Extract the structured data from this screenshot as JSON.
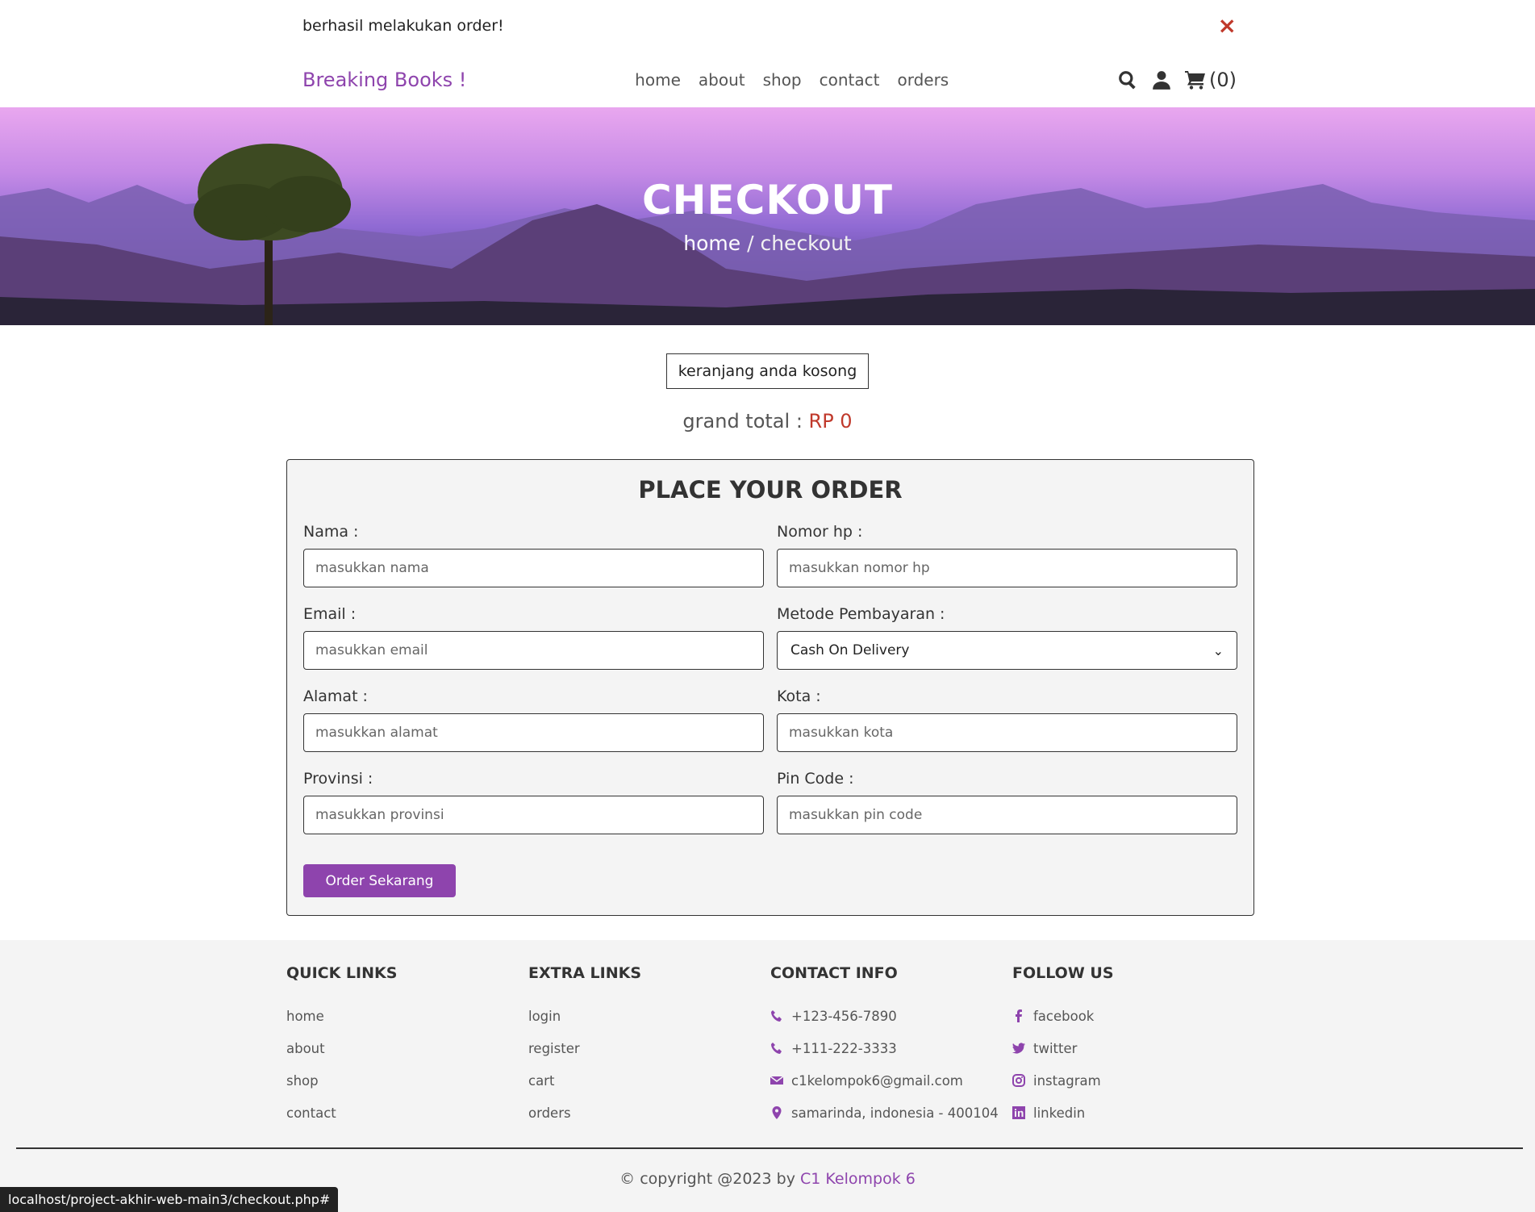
{
  "message": {
    "text": "berhasil melakukan order!",
    "close_icon": "×"
  },
  "header": {
    "logo": "Breaking Books !",
    "nav": [
      "home",
      "about",
      "shop",
      "contact",
      "orders"
    ],
    "cart_count": "(0)"
  },
  "heading": {
    "title": "CHECKOUT",
    "crumb_home": "home",
    "crumb_sep": " / ",
    "crumb_current": "checkout"
  },
  "cart": {
    "empty_text": "keranjang anda kosong",
    "grand_total_label": "grand total : ",
    "grand_total_value": "RP 0"
  },
  "form": {
    "title": "PLACE YOUR ORDER",
    "fields": [
      {
        "label": "Nama :",
        "placeholder": "masukkan nama"
      },
      {
        "label": "Nomor hp :",
        "placeholder": "masukkan nomor hp"
      },
      {
        "label": "Email :",
        "placeholder": "masukkan email"
      },
      {
        "label": "Metode Pembayaran :",
        "selected": "Cash On Delivery"
      },
      {
        "label": "Alamat :",
        "placeholder": "masukkan alamat"
      },
      {
        "label": "Kota :",
        "placeholder": "masukkan kota"
      },
      {
        "label": "Provinsi :",
        "placeholder": "masukkan provinsi"
      },
      {
        "label": "Pin Code :",
        "placeholder": "masukkan pin code"
      }
    ],
    "submit": "Order Sekarang"
  },
  "footer": {
    "quick_links": {
      "title": "QUICK LINKS",
      "items": [
        "home",
        "about",
        "shop",
        "contact"
      ]
    },
    "extra_links": {
      "title": "EXTRA LINKS",
      "items": [
        "login",
        "register",
        "cart",
        "orders"
      ]
    },
    "contact_info": {
      "title": "CONTACT INFO",
      "items": [
        {
          "icon": "phone-icon",
          "text": "+123-456-7890"
        },
        {
          "icon": "phone-icon",
          "text": "+111-222-3333"
        },
        {
          "icon": "envelope-icon",
          "text": "c1kelompok6@gmail.com"
        },
        {
          "icon": "map-marker-icon",
          "text": "samarinda, indonesia - 400104"
        }
      ]
    },
    "follow_us": {
      "title": "FOLLOW US",
      "items": [
        {
          "icon": "facebook-icon",
          "text": "facebook"
        },
        {
          "icon": "twitter-icon",
          "text": "twitter"
        },
        {
          "icon": "instagram-icon",
          "text": "instagram"
        },
        {
          "icon": "linkedin-icon",
          "text": "linkedin"
        }
      ]
    },
    "credit_prefix": "© copyright @2023 by ",
    "credit_name": "C1 Kelompok 6"
  },
  "status_url": "localhost/project-akhir-web-main3/checkout.php#",
  "colors": {
    "accent": "#8e44ad",
    "danger": "#c0392b",
    "text": "#333333",
    "panel": "#f4f4f4"
  }
}
